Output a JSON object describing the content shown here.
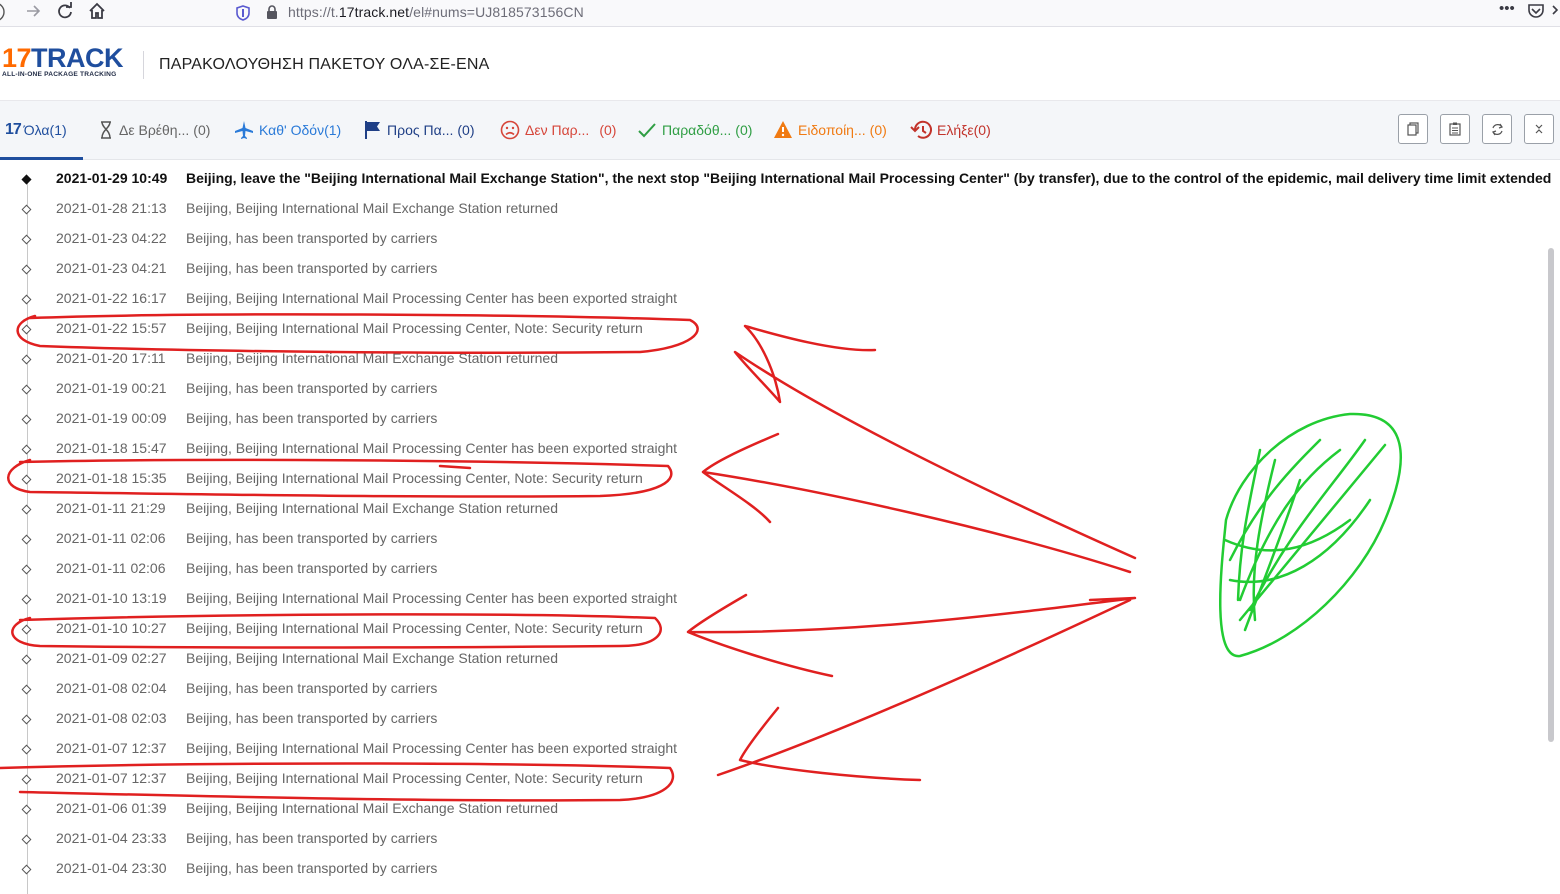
{
  "browser": {
    "url_prefix": "https://t.",
    "url_host": "17track.net",
    "url_suffix": "/el#nums=UJ818573156CN",
    "more_label": "•••"
  },
  "header": {
    "logo_17": "17",
    "logo_track": "TRACK",
    "logo_tagline": "ALL-IN-ONE PACKAGE TRACKING",
    "title": "ΠΑΡΑΚΟΛΟΥΘΗΣΗ ΠΑΚΕΤΟΥ ΟΛΑ-ΣΕ-ΕΝΑ"
  },
  "tabs": [
    {
      "label": "Όλα",
      "count": "(1)",
      "color": "#1f4e9e",
      "icon": "17-icon"
    },
    {
      "label": "Δε Βρέθη...",
      "count": "(0)",
      "color": "#666666",
      "icon": "hourglass-icon"
    },
    {
      "label": "Καθ' Οδόν",
      "count": "(1)",
      "color": "#2a7ad8",
      "icon": "airplane-icon"
    },
    {
      "label": "Προς Πα...",
      "count": "(0)",
      "color": "#1f3f86",
      "icon": "flag-icon"
    },
    {
      "label": "Δεν Παρ...",
      "count": "(0)",
      "color": "#d6463a",
      "icon": "sad-face-icon"
    },
    {
      "label": "Παραδόθ...",
      "count": "(0)",
      "color": "#2f9e44",
      "icon": "checkmark-icon"
    },
    {
      "label": "Ειδοποίη...",
      "count": "(0)",
      "color": "#f07a12",
      "icon": "warning-icon"
    },
    {
      "label": "Ελήξε",
      "count": "(0)",
      "color": "#c2332b",
      "icon": "history-icon"
    }
  ],
  "actions": [
    "copy-icon",
    "paste-icon",
    "refresh-icon",
    "collapse-icon"
  ],
  "events": [
    {
      "time": "2021-01-29 10:49",
      "desc": "Beijing, leave the \"Beijing International Mail Exchange Station\", the next stop \"Beijing International Mail Processing Center\" (by transfer), due to the control of the epidemic, mail delivery time limit extended"
    },
    {
      "time": "2021-01-28 21:13",
      "desc": "Beijing, Beijing International Mail Exchange Station returned"
    },
    {
      "time": "2021-01-23 04:22",
      "desc": "Beijing, has been transported by carriers"
    },
    {
      "time": "2021-01-23 04:21",
      "desc": "Beijing, has been transported by carriers"
    },
    {
      "time": "2021-01-22 16:17",
      "desc": "Beijing, Beijing International Mail Processing Center has been exported straight"
    },
    {
      "time": "2021-01-22 15:57",
      "desc": "Beijing, Beijing International Mail Processing Center, Note: Security return"
    },
    {
      "time": "2021-01-20 17:11",
      "desc": "Beijing, Beijing International Mail Exchange Station returned"
    },
    {
      "time": "2021-01-19 00:21",
      "desc": "Beijing, has been transported by carriers"
    },
    {
      "time": "2021-01-19 00:09",
      "desc": "Beijing, has been transported by carriers"
    },
    {
      "time": "2021-01-18 15:47",
      "desc": "Beijing, Beijing International Mail Processing Center has been exported straight"
    },
    {
      "time": "2021-01-18 15:35",
      "desc": "Beijing, Beijing International Mail Processing Center, Note: Security return"
    },
    {
      "time": "2021-01-11 21:29",
      "desc": "Beijing, Beijing International Mail Exchange Station returned"
    },
    {
      "time": "2021-01-11 02:06",
      "desc": "Beijing, has been transported by carriers"
    },
    {
      "time": "2021-01-11 02:06",
      "desc": "Beijing, has been transported by carriers"
    },
    {
      "time": "2021-01-10 13:19",
      "desc": "Beijing, Beijing International Mail Processing Center has been exported straight"
    },
    {
      "time": "2021-01-10 10:27",
      "desc": "Beijing, Beijing International Mail Processing Center, Note: Security return"
    },
    {
      "time": "2021-01-09 02:27",
      "desc": "Beijing, Beijing International Mail Exchange Station returned"
    },
    {
      "time": "2021-01-08 02:04",
      "desc": "Beijing, has been transported by carriers"
    },
    {
      "time": "2021-01-08 02:03",
      "desc": "Beijing, has been transported by carriers"
    },
    {
      "time": "2021-01-07 12:37",
      "desc": "Beijing, Beijing International Mail Processing Center has been exported straight"
    },
    {
      "time": "2021-01-07 12:37",
      "desc": "Beijing, Beijing International Mail Processing Center, Note: Security return"
    },
    {
      "time": "2021-01-06 01:39",
      "desc": "Beijing, Beijing International Mail Exchange Station returned"
    },
    {
      "time": "2021-01-04 23:33",
      "desc": "Beijing, has been transported by carriers"
    },
    {
      "time": "2021-01-04 23:30",
      "desc": "Beijing, has been transported by carriers"
    }
  ],
  "annotation_colors": {
    "circles_arrows": "#e02020",
    "scribble": "#22cc33"
  }
}
